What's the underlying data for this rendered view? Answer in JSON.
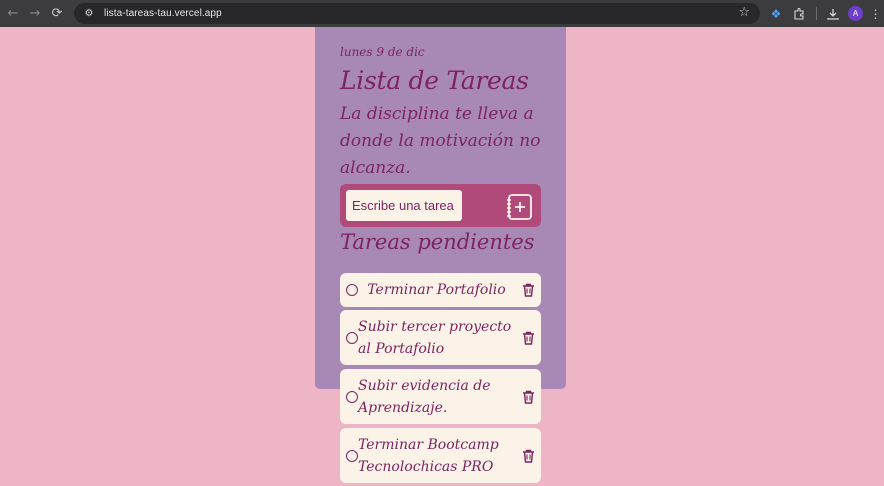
{
  "browser": {
    "url": "lista-tareas-tau.vercel.app",
    "avatar_letter": "A"
  },
  "app": {
    "date": "lunes 9 de dic",
    "title": "Lista de Tareas",
    "motto": "La disciplina te lleva a donde la motivación no alcanza.",
    "input_placeholder": "Escribe una tarea",
    "pending_heading": "Tareas pendientes",
    "tasks": [
      {
        "text": "Terminar Portafolio"
      },
      {
        "text": "Subir tercer proyecto al Portafolio"
      },
      {
        "text": "Subir evidencia de Aprendizaje."
      },
      {
        "text": "Terminar Bootcamp Tecnolochicas PRO"
      }
    ]
  },
  "colors": {
    "page_background": "#eeb5c6",
    "card_background": "#a889b6",
    "accent": "#7d2460",
    "input_bar": "#b04a7b",
    "task_background": "#fcf3e8"
  },
  "icons": {
    "back": "back-arrow-icon",
    "forward": "forward-arrow-icon",
    "reload": "reload-icon",
    "site_info": "site-info-icon",
    "bookmark": "star-icon",
    "extension": "extension-icon",
    "extensions": "puzzle-icon",
    "download": "download-icon",
    "menu": "kebab-menu-icon",
    "add_task": "notebook-plus-icon",
    "delete_task": "trash-icon"
  }
}
